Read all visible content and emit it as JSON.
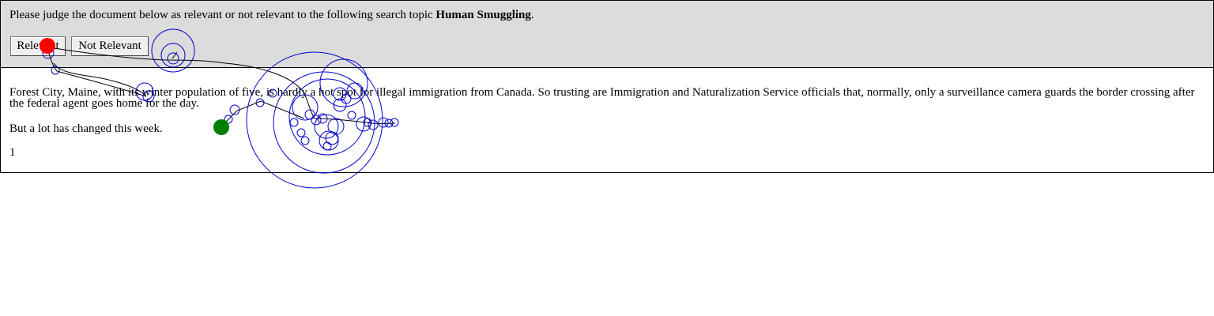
{
  "header": {
    "prompt_prefix": "Please judge the document below as relevant or not relevant to the following search topic ",
    "topic": "Human Smuggling",
    "prompt_suffix": "."
  },
  "buttons": {
    "relevant_label": "Relevant",
    "not_relevant_label": "Not Relevant"
  },
  "document": {
    "paragraph_1": "Forest City, Maine, with its winter population of five, is hardly a hot spot for illegal immigration from Canada. So trusting are Immigration and Naturalization Service officials that, normally, only a surveillance camera guards the border crossing after the federal agent goes home for the day.",
    "paragraph_2": "But a lot has changed this week.",
    "page_number": "1"
  },
  "gaze_overlay": {
    "fixation_color": "#0000cc",
    "path_color": "#000000",
    "start_marker_color": "#008000",
    "end_marker_color": "#ff0000"
  }
}
